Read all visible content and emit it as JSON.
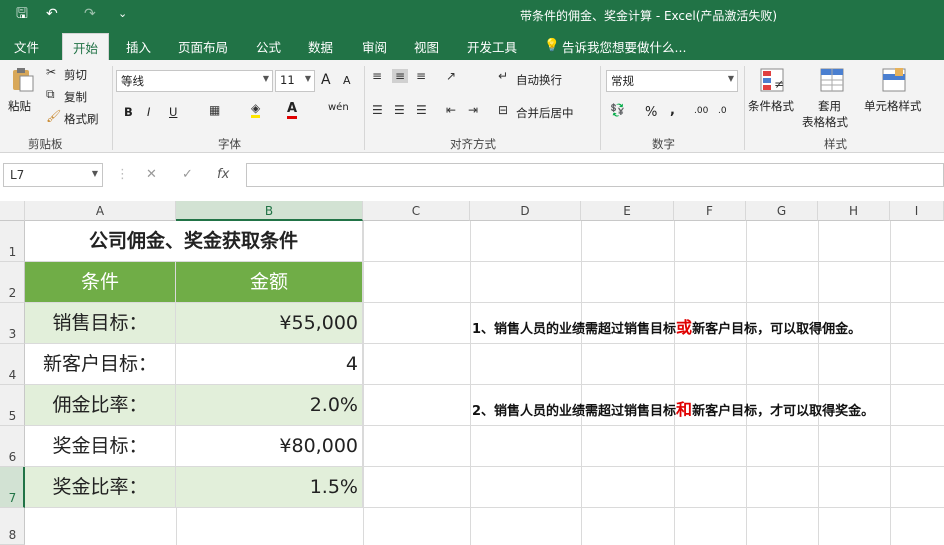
{
  "window": {
    "title": "带条件的佣金、奖金计算 - Excel(产品激活失败)",
    "quick_access": {
      "save": "🖫",
      "undo": "↶",
      "redo": "↷",
      "customize": "⌄"
    }
  },
  "ribbon_tabs": [
    "文件",
    "开始",
    "插入",
    "页面布局",
    "公式",
    "数据",
    "审阅",
    "视图",
    "开发工具"
  ],
  "tell_me": "告诉我您想要做什么...",
  "clipboard": {
    "paste": "粘贴",
    "cut": "剪切",
    "copy": "复制",
    "format_painter": "格式刷",
    "group": "剪贴板"
  },
  "font": {
    "name": "等线",
    "size": "11",
    "bold": "B",
    "italic": "I",
    "underline": "U",
    "increase": "A",
    "decrease": "A",
    "group": "字体",
    "wen": "wén"
  },
  "alignment": {
    "wrap": "自动换行",
    "merge": "合并后居中",
    "group": "对齐方式"
  },
  "number": {
    "format": "常规",
    "percent": "%",
    "comma": ",",
    "group": "数字",
    "inc": ".00",
    "dec": ".0"
  },
  "styles": {
    "conditional": "条件格式",
    "table_l1": "套用",
    "table_l2": "表格格式",
    "cell_styles": "单元格样式",
    "group": "样式"
  },
  "formula_bar": {
    "name_box": "L7",
    "cancel": "✕",
    "confirm": "✓",
    "fx": "fx",
    "value": ""
  },
  "columns": [
    "A",
    "B",
    "C",
    "D",
    "E",
    "F",
    "G",
    "H",
    "I"
  ],
  "rows": [
    "1",
    "2",
    "3",
    "4",
    "5",
    "6",
    "7",
    "8"
  ],
  "sheet": {
    "title": "公司佣金、奖金获取条件",
    "header": {
      "col1": "条件",
      "col2": "金额"
    },
    "items": [
      {
        "label": "销售目标：",
        "value": "¥55,000"
      },
      {
        "label": "新客户目标：",
        "value": "4"
      },
      {
        "label": "佣金比率：",
        "value": "2.0%"
      },
      {
        "label": "奖金目标：",
        "value": "¥80,000"
      },
      {
        "label": "奖金比率：",
        "value": "1.5%"
      }
    ],
    "note1": {
      "before": "1、销售人员的业绩需超过销售目标",
      "key": "或",
      "after": "新客户目标，可以取得佣金。"
    },
    "note2": {
      "before": "2、销售人员的业绩需超过销售目标",
      "key": "和",
      "after": "新客户目标，才可以取得奖金。"
    }
  },
  "colors": {
    "excel_green": "#217346",
    "header_fill": "#70ad47",
    "light_fill": "#e2efda",
    "highlight_red": "#e00000"
  }
}
